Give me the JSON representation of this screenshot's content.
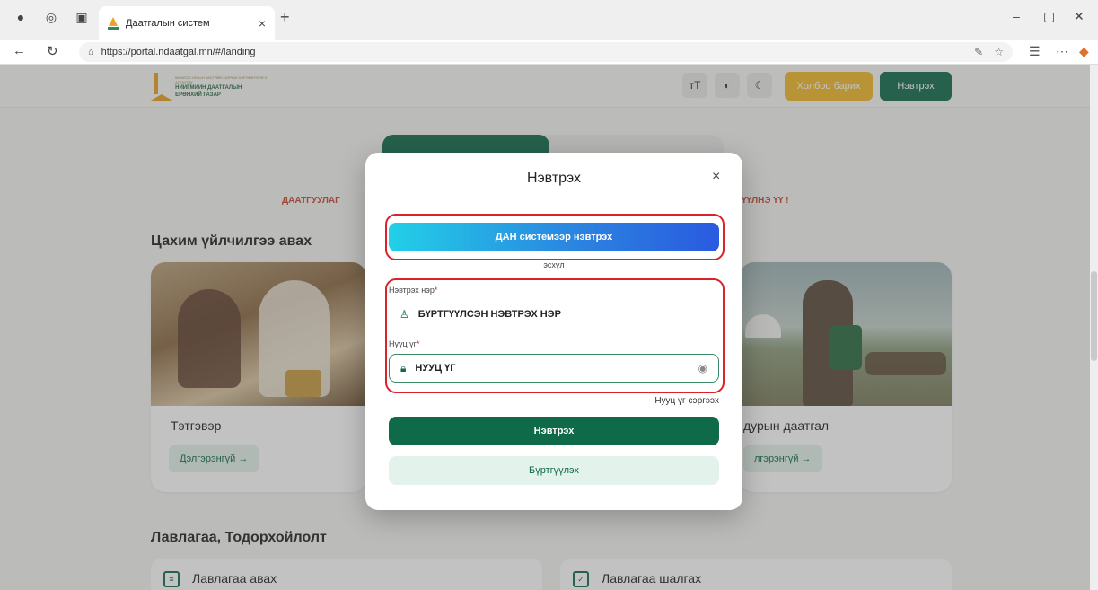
{
  "browser": {
    "tab_title": "Даатгалын систем",
    "tab_close": "×",
    "new_tab": "+",
    "url": "https://portal.ndaatgal.mn/#/landing",
    "win_min": "–",
    "win_max": "▢",
    "win_close": "✕"
  },
  "site": {
    "logo_sup": "МОНГОЛ УЛСЫН ЗАСГИЙН ГАЗРЫН ХЭРЭГЖҮҮЛЭГЧ АГЕНТЛАГ",
    "logo_line1": "НИЙГМИЙН ДААТГАЛЫН",
    "logo_line2": "ЕРӨНХИЙ ГАЗАР",
    "font_btn": "тT",
    "contact_label": "Холбоо барих",
    "login_label": "Нэвтрэх"
  },
  "main": {
    "warn_left": "ДААТГУУЛАГ",
    "warn_right": "ҮҮЛНЭ ҮҮ !",
    "section_title": "Цахим үйлчилгээ авах",
    "card_left_title": "Тэтгэвэр",
    "card_left_more": "Дэлгэрэнгүй →",
    "card_right_title": "дурын даатгал",
    "card_right_more": "лгэрэнгүй →",
    "ref_title": "Лавлагаа, Тодорхойлолт",
    "ref_items": [
      "Лавлагаа авах",
      "Лавлагаа шалгах"
    ]
  },
  "modal": {
    "title": "Нэвтрэх",
    "close": "×",
    "dan_label": "ДАН системээр нэвтрэх",
    "or_text": "эсхүл",
    "username_label": "Нэвтрэх нэр",
    "username_value": "БҮРТГҮҮЛСЭН НЭВТРЭХ НЭР",
    "password_label": "Нууц үг",
    "password_value": "НУУЦ ҮГ",
    "required_mark": "*",
    "forgot_label": "Нууц үг сэргээх",
    "submit_label": "Нэвтрэх",
    "register_label": "Бүртгүүлэх"
  },
  "colors": {
    "primary": "#0f6a4a",
    "accent": "#f0b92a",
    "highlight": "#d8232a"
  }
}
